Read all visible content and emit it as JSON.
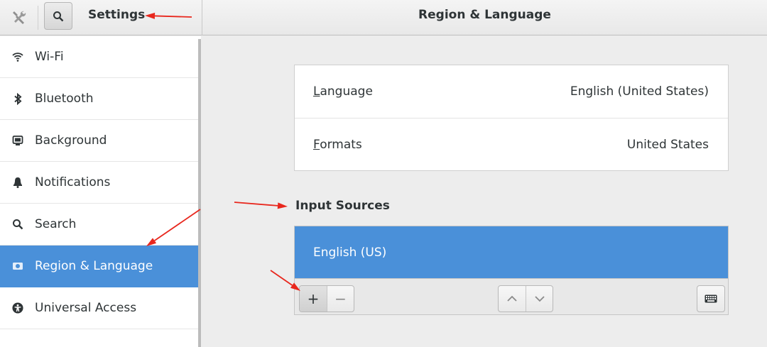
{
  "header": {
    "tools_icon": "tools-icon",
    "search_icon": "search-icon",
    "left_title": "Settings",
    "main_title": "Region & Language"
  },
  "sidebar": {
    "items": [
      {
        "label": "Wi-Fi",
        "icon": "wifi-icon",
        "selected": false
      },
      {
        "label": "Bluetooth",
        "icon": "bluetooth-icon",
        "selected": false
      },
      {
        "label": "Background",
        "icon": "background-icon",
        "selected": false
      },
      {
        "label": "Notifications",
        "icon": "bell-icon",
        "selected": false
      },
      {
        "label": "Search",
        "icon": "search-icon",
        "selected": false
      },
      {
        "label": "Region & Language",
        "icon": "region-icon",
        "selected": true
      },
      {
        "label": "Universal Access",
        "icon": "accessibility-icon",
        "selected": false
      }
    ]
  },
  "region": {
    "language_label": "Language",
    "language_mnemonic": "L",
    "language_rest": "anguage",
    "language_value": "English (United States)",
    "formats_label": "Formats",
    "formats_mnemonic": "F",
    "formats_rest": "ormats",
    "formats_value": "United States"
  },
  "input_sources": {
    "title": "Input Sources",
    "items": [
      {
        "label": "English (US)",
        "selected": true
      }
    ],
    "toolbar": {
      "add_label": "+",
      "remove_label": "−",
      "up_icon": "chevron-up-icon",
      "down_icon": "chevron-down-icon",
      "keyboard_icon": "keyboard-icon"
    }
  },
  "colors": {
    "accent": "#4a90d9",
    "annotation": "#e8271d"
  }
}
